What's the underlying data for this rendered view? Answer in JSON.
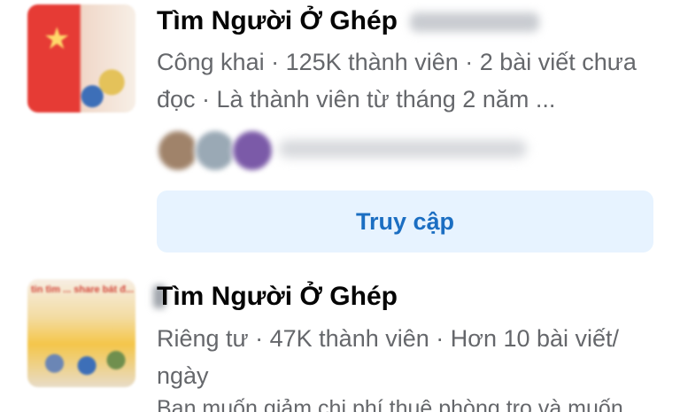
{
  "groups": [
    {
      "title": "Tìm Người Ở Ghép",
      "meta": "Công khai · 125K thành viên · 2 bài viết chưa đọc · Là thành viên từ tháng 2 năm ...",
      "button_label": "Truy cập"
    },
    {
      "title": "Tìm Người Ở Ghép",
      "meta": "Riêng tư · 47K thành viên · Hơn 10 bài viết/ ngày",
      "description": "Bạn muốn giảm chi phí thuê phòng trọ và muốn"
    }
  ],
  "thumb_text": "tin tìm ... share bát đ..."
}
